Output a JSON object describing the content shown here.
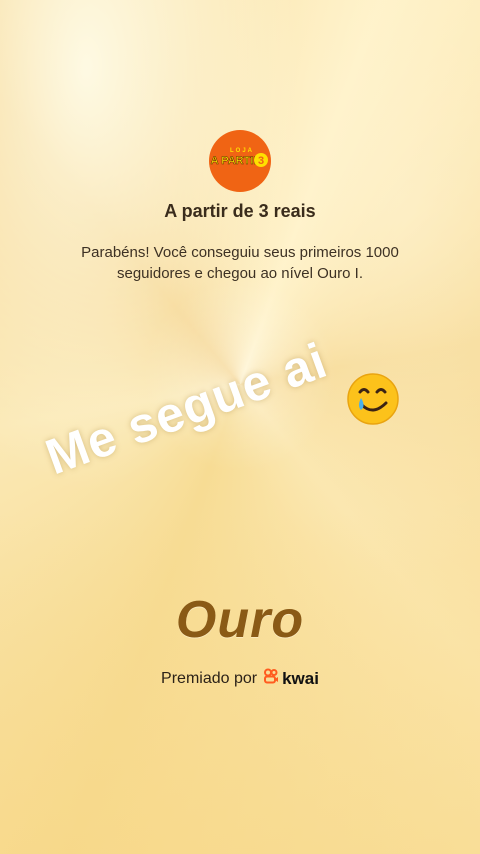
{
  "store": {
    "logo_text_top": "LOJA",
    "logo_text_main": "A PARTIR",
    "logo_number": "3",
    "name": "A partir de 3 reais"
  },
  "message": "Parabéns! Você conseguiu seus primeiros 1000 seguidores e chegou ao nível Ouro I.",
  "sticker_text": "Me segue ai",
  "emoji_icon": "smiling-face-with-tear-icon",
  "level_name": "Ouro",
  "award": {
    "prefix": "Premiado por",
    "brand": "kwai",
    "brand_color": "#ff5c1f"
  },
  "colors": {
    "logo_bg": "#f06414",
    "logo_text": "#ffe000",
    "level_text": "#8a5a16"
  }
}
